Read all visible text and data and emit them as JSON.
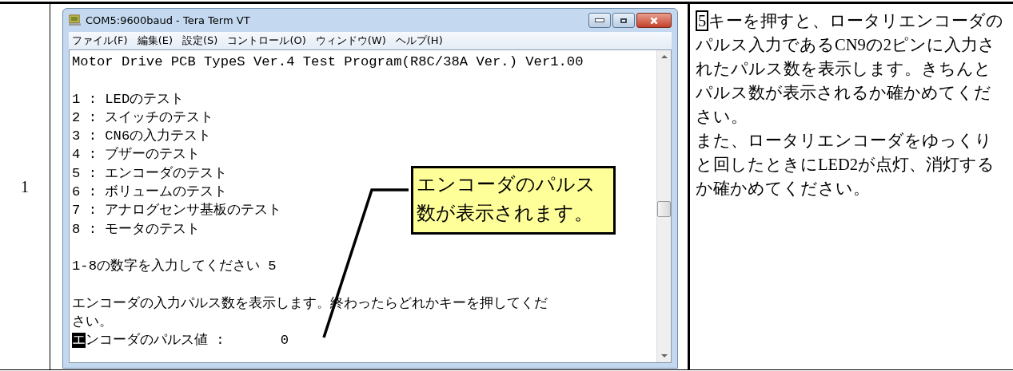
{
  "row": {
    "number": "1",
    "window": {
      "title": "COM5:9600baud - Tera Term VT",
      "menu": [
        "ファイル(F)",
        "編集(E)",
        "設定(S)",
        "コントロール(O)",
        "ウィンドウ(W)",
        "ヘルプ(H)"
      ],
      "lines": [
        {
          "kind": "text",
          "space_before": false,
          "text": "Motor Drive PCB TypeS Ver.4 Test Program(R8C/38A Ver.) Ver1.00"
        },
        {
          "kind": "text",
          "space_before": true,
          "text": "1 : LEDのテスト"
        },
        {
          "kind": "text",
          "space_before": false,
          "text": "2 : スイッチのテスト"
        },
        {
          "kind": "text",
          "space_before": false,
          "text": "3 : CN6の入力テスト"
        },
        {
          "kind": "text",
          "space_before": false,
          "text": "4 : ブザーのテスト"
        },
        {
          "kind": "text",
          "space_before": false,
          "text": "5 : エンコーダのテスト"
        },
        {
          "kind": "text",
          "space_before": false,
          "text": "6 : ボリュームのテスト"
        },
        {
          "kind": "text",
          "space_before": false,
          "text": "7 : アナログセンサ基板のテスト"
        },
        {
          "kind": "text",
          "space_before": false,
          "text": "8 : モータのテスト"
        },
        {
          "kind": "text",
          "space_before": true,
          "text": "1-8の数字を入力してください 5"
        },
        {
          "kind": "text",
          "space_before": true,
          "text": "エンコーダの入力パルス数を表示します。終わったらどれかキーを押してくだ"
        },
        {
          "kind": "text",
          "space_before": false,
          "text": "さい。"
        },
        {
          "kind": "cursor",
          "space_before": false,
          "text": "エンコーダのパルス値 :",
          "value": "0"
        }
      ]
    },
    "callout": "エンコーダのパルス数が表示されます。",
    "description": [
      {
        "key": "5",
        "text": "キーを押すと、ロータリエンコーダのパルス入力であるCN9の2ピンに入力されたパルス数を表示します。きちんとパルス数が表示されるか確かめてください。"
      },
      {
        "text": "また、ロータリエンコーダをゆっくりと回したときにLED2が点灯、消灯するか確かめてください。"
      }
    ]
  }
}
